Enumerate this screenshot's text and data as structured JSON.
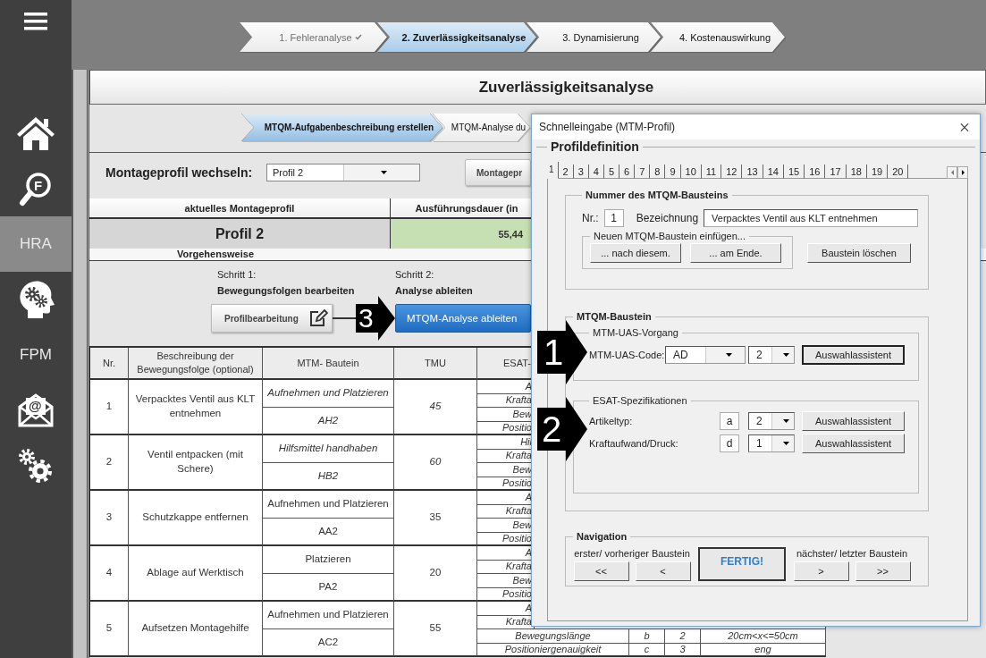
{
  "sidebar": {
    "items": [
      {
        "kind": "home",
        "selected": false
      },
      {
        "kind": "search",
        "label": "F",
        "selected": false
      },
      {
        "kind": "text",
        "label": "HRA",
        "selected": true
      },
      {
        "kind": "head",
        "selected": false
      },
      {
        "kind": "text",
        "label": "FPM",
        "selected": false
      },
      {
        "kind": "mail",
        "label": "@",
        "selected": false
      },
      {
        "kind": "settings",
        "selected": false
      }
    ]
  },
  "top_steps": [
    {
      "label": "1. Fehleranalyse",
      "done": true,
      "selected": false
    },
    {
      "label": "2. Zuverlässigkeitsanalyse",
      "done": false,
      "selected": true
    },
    {
      "label": "3. Dynamisierung",
      "done": false,
      "selected": false
    },
    {
      "label": "4. Kostenauswirkung",
      "done": false,
      "selected": false
    }
  ],
  "page_title": "Zuverlässigkeitsanalyse",
  "sub_steps": [
    {
      "label": "MTQM-Aufgabenbeschreibung erstellen",
      "selected": true
    },
    {
      "label": "MTQM-Analyse du",
      "selected": false
    }
  ],
  "profile_switch": {
    "label": "Montageprofil wechseln:",
    "value": "Profil 2",
    "button": "Montagepr"
  },
  "summary": {
    "columns": [
      "aktuelles Montageprofil",
      "Ausführungsdauer (in"
    ],
    "profile": "Profil 2",
    "duration": "55,44"
  },
  "procedure": {
    "title": "Vorgehensweise",
    "marker": "3",
    "steps": [
      {
        "step": "Schritt 1:",
        "action": "Bewegungsfolgen bearbeiten",
        "button": "Profilbearbeitung"
      },
      {
        "step": "Schritt 2:",
        "action": "Analyse ableiten",
        "button": "MTQM-Analyse ableiten"
      }
    ]
  },
  "table": {
    "columns": [
      "Nr.",
      "Beschreibung der Bewegungsfolge (optional)",
      "MTM- Bautein",
      "TMU",
      "ESAT-"
    ],
    "rows": [
      {
        "nr": "1",
        "description": "Verpacktes Ventil aus KLT entnehmen",
        "operation": "Aufnehmen und Platzieren",
        "code": "AH2",
        "tmu": "45",
        "italic": true,
        "esat": [
          {
            "label": "A"
          },
          {
            "label": "Krafta"
          },
          {
            "label": "Bew"
          },
          {
            "label": "Positio"
          }
        ]
      },
      {
        "nr": "2",
        "description": "Ventil entpacken (mit Schere)",
        "operation": "Hilfsmittel handhaben",
        "code": "HB2",
        "tmu": "60",
        "italic": true,
        "esat": [
          {
            "label": "Hil"
          },
          {
            "label": "Krafta"
          },
          {
            "label": "Bew"
          },
          {
            "label": "Positio"
          }
        ]
      },
      {
        "nr": "3",
        "description": "Schutzkappe entfernen",
        "operation": "Aufnehmen und Platzieren",
        "code": "AA2",
        "tmu": "35",
        "italic": false,
        "esat": [
          {
            "label": "A"
          },
          {
            "label": "Krafta"
          },
          {
            "label": "Bew"
          },
          {
            "label": "Positio"
          }
        ]
      },
      {
        "nr": "4",
        "description": "Ablage auf Werktisch",
        "operation": "Platzieren",
        "code": "PA2",
        "tmu": "20",
        "italic": false,
        "esat": [
          {
            "label": "A"
          },
          {
            "label": "Krafta"
          },
          {
            "label": "Bew"
          },
          {
            "label": "Positio"
          }
        ]
      },
      {
        "nr": "5",
        "description": "Aufsetzen Montagehilfe",
        "operation": "Aufnehmen und Platzieren",
        "code": "AC2",
        "tmu": "55",
        "italic": false,
        "esat": [
          {
            "label": "A"
          },
          {
            "label": "Krafta"
          },
          {
            "label": "Bewegungslänge",
            "letter": "b",
            "value": "2",
            "description": "20cm<x<=50cm"
          },
          {
            "label": "Positioniergenauigkeit",
            "letter": "c",
            "value": "3",
            "description": "eng"
          }
        ]
      }
    ]
  },
  "dialog": {
    "title": "Schnelleingabe (MTM-Profil)",
    "frame": "Profildefinition",
    "tabs": [
      {
        "label": "1",
        "selected": true
      },
      {
        "label": "2",
        "selected": false
      },
      {
        "label": "3",
        "selected": false
      },
      {
        "label": "4",
        "selected": false
      },
      {
        "label": "5",
        "selected": false
      },
      {
        "label": "6",
        "selected": false
      },
      {
        "label": "7",
        "selected": false
      },
      {
        "label": "8",
        "selected": false
      },
      {
        "label": "9",
        "selected": false
      },
      {
        "label": "10",
        "selected": false
      },
      {
        "label": "11",
        "selected": false
      },
      {
        "label": "12",
        "selected": false
      },
      {
        "label": "13",
        "selected": false
      },
      {
        "label": "14",
        "selected": false
      },
      {
        "label": "15",
        "selected": false
      },
      {
        "label": "16",
        "selected": false
      },
      {
        "label": "17",
        "selected": false
      },
      {
        "label": "18",
        "selected": false
      },
      {
        "label": "19",
        "selected": false
      },
      {
        "label": "20",
        "selected": false
      }
    ],
    "number_group": {
      "title": "Nummer des MTQM-Bausteins",
      "nr_label": "Nr.:",
      "nr": "1",
      "name_label": "Bezeichnung",
      "name": "Verpacktes Ventil aus KLT entnehmen",
      "insert_title": "Neuen MTQM-Baustein einfügen...",
      "insert_buttons": [
        "... nach diesem.",
        "... am Ende."
      ],
      "delete_button": "Baustein löschen"
    },
    "component_group": {
      "title": "MTQM-Baustein",
      "uas": {
        "title": "MTM-UAS-Vorgang",
        "marker": "1",
        "label": "MTM-UAS-Code:",
        "code": "AD",
        "number": "2",
        "button": "Auswahlassistent"
      },
      "esat": {
        "title": "ESAT-Spezifikationen",
        "marker": "2",
        "rows": [
          {
            "label": "Artikeltyp:",
            "letter": "a",
            "value": "2",
            "button": "Auswahlassistent"
          },
          {
            "label": "Kraftaufwand/Druck:",
            "letter": "d",
            "value": "1",
            "button": "Auswahlassistent"
          }
        ]
      }
    },
    "navigation": {
      "title": "Navigation",
      "back_label": "erster/ vorheriger Baustein",
      "back_buttons": [
        "<<",
        "<"
      ],
      "finish": "FERTIG!",
      "next_label": "nächster/ letzter Baustein",
      "next_buttons": [
        ">",
        ">>"
      ]
    }
  }
}
